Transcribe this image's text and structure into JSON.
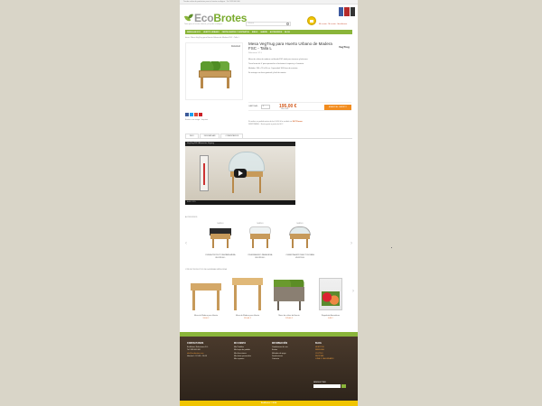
{
  "site": {
    "topbar": "Tienda online de productos para tu huerto ecológico · Tel. 983 000 000",
    "logo_prefix": "Eco",
    "logo_suffix": "Brotes",
    "tagline": "Todo para el huerto urbano y el jardín ecológico",
    "search_placeholder": "Buscar",
    "user_links": "Mi cuenta · Mi carrito · Identificarse"
  },
  "nav": {
    "items": [
      "SEMILLAS ECO",
      "HUERTO URBANO",
      "FERTILIZANTES Y SUSTRATOS",
      "RIEGO",
      "JARDÍN",
      "ACCESORIOS",
      "BLOG"
    ]
  },
  "breadcrumb": "Inicio › Mesa VegTrug para Huerto Urbano de Madera FSC - Talla L",
  "product": {
    "sale_tag": "OFERTA",
    "title": "Mesa VegTrug para Huerto Urbano de Madera FSC - Talla L",
    "reference": "Referencia: VT-L",
    "brand": "VegTrug",
    "description": [
      "Mesa de cultivo de madera certificada FSC ideal para terrazas y balcones.",
      "Tiene forma de V para aprovechar al máximo el espacio y el sustrato.",
      "Medidas: 180 x 78 x 80 cm. Capacidad: 300 litros de sustrato.",
      "Se entrega con forro geotextil y fácil de montar."
    ],
    "qty_label": "CANTIDAD:",
    "qty_value": "1",
    "price": "195,00 €",
    "iva": "IVA incluido",
    "add_to_cart": "AÑADIR AL CARRITO",
    "stock_text": "Si realiza su pedido antes de las 14:00 h lo recibirá en ",
    "stock_highlight": "24-72 horas",
    "stock_note": "DISPONIBLE · Envío gratis a partir de 60 €"
  },
  "share": {
    "note": "Enviar a un amigo · Imprimir"
  },
  "tabs": [
    "INFO",
    "DESCARGAR",
    "COMENTARIOS"
  ],
  "video": {
    "title": "VegTrug 2013 Alternative Vegtrug",
    "controls": "0:00 / 2:15"
  },
  "accessories": {
    "label": "ACCESORIOS",
    "items": [
      {
        "badge": "NUEVO",
        "name": "FUNDA PROTECTORA PARA MESA VEGTRUG L"
      },
      {
        "badge": "NUEVO",
        "name": "INVERNADERO PARA MESA VEGTRUG L"
      },
      {
        "badge": "NUEVO",
        "name": "CUBIERTA ANTI INSECTOS PARA VEGTRUG"
      }
    ]
  },
  "related": {
    "label": "OTROS PRODUCTOS DE LA MISMA CATEGORÍA",
    "items": [
      {
        "name": "Mesa de Madera para Huerto",
        "price": "99,90 €"
      },
      {
        "name": "Mesa de Madera para Huerto",
        "price": "115,00 €"
      },
      {
        "name": "Mesa de cultivo de Huerto",
        "price": "129,00 €"
      },
      {
        "name": "Regaderita Aromáticas",
        "price": "8,95 €"
      }
    ]
  },
  "footer": {
    "contact": {
      "title": "CONTACTANOS",
      "lines": [
        "EcoBrotes Soluciones S.L.",
        "Tel. 983 000 000",
        "info@ecobrotes.com",
        "Horario: L-V 9:00 - 14:00"
      ]
    },
    "account": {
      "title": "MI CUENTA",
      "lines": [
        "Mis Pedidos",
        "Mis bajas de pedido",
        "Mis direcciones",
        "Mis datos personales",
        "Mis cupones"
      ]
    },
    "info": {
      "title": "INFORMACIÓN",
      "lines": [
        "Condiciones de uso",
        "Envíos",
        "Métodos de pago",
        "Devoluciones",
        "Contacto"
      ]
    },
    "blog": {
      "title": "BLOG",
      "lines": [
        "HUERTOS",
        "SEMILLAS",
        "CULTIVO",
        "RECETAS",
        "LUNA Y CALENDARIO"
      ]
    },
    "newsletter_title": "NEWSLETTER",
    "bottom": "EcoBrotes © 2014"
  },
  "colors": {
    "brand_green": "#8ab53a",
    "price_orange": "#d35b1e",
    "button_orange": "#f28c1e",
    "footer_brown": "#4a3a2c",
    "bottom_yellow": "#f0c400"
  }
}
